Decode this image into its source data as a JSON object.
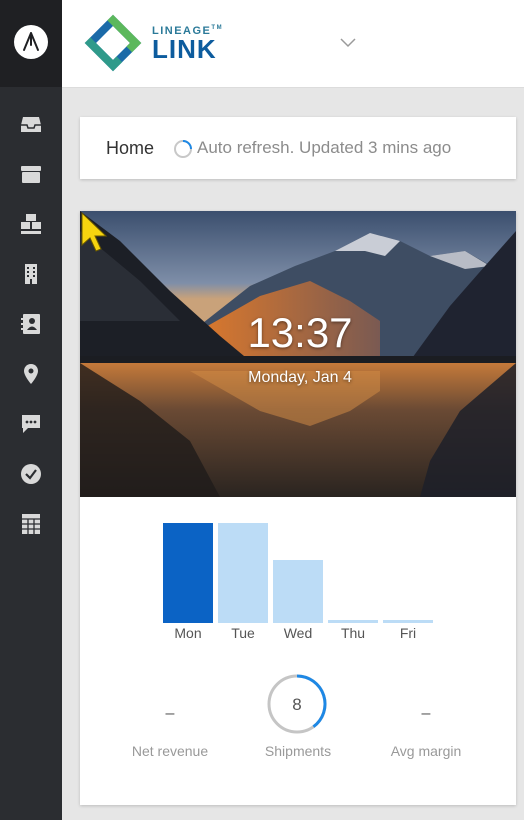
{
  "brand": {
    "line1": "LINEAGE",
    "tm": "TM",
    "line2": "LINK"
  },
  "breadcrumb": {
    "home": "Home",
    "refresh_text": "Auto refresh. Updated 3 mins ago"
  },
  "clock": {
    "time": "13:37",
    "date": "Monday, Jan 4"
  },
  "sidebar": {
    "items": [
      {
        "icon": "inbox-icon"
      },
      {
        "icon": "box-icon"
      },
      {
        "icon": "pallets-icon"
      },
      {
        "icon": "building-icon"
      },
      {
        "icon": "contacts-icon"
      },
      {
        "icon": "location-pin-icon"
      },
      {
        "icon": "chat-icon"
      },
      {
        "icon": "check-circle-icon"
      },
      {
        "icon": "spreadsheet-icon"
      }
    ]
  },
  "chart_data": {
    "type": "bar",
    "categories": [
      "Mon",
      "Tue",
      "Wed",
      "Thu",
      "Fri"
    ],
    "values": [
      100,
      100,
      63,
      3,
      3
    ],
    "highlight_index": 0,
    "highlight_color": "#0b63c5",
    "bar_color": "#bcdcf6",
    "ylim": [
      0,
      100
    ]
  },
  "stats": {
    "net_revenue": {
      "value": "–",
      "label": "Net revenue"
    },
    "shipments": {
      "value": "8",
      "label": "Shipments",
      "ring_progress": 0.4
    },
    "avg_margin": {
      "value": "–",
      "label": "Avg margin"
    }
  },
  "colors": {
    "sidebar": "#2b2d31",
    "accent": "#1e88e5",
    "brand_blue": "#0d5c9e",
    "brand_green": "#5cb85c"
  }
}
